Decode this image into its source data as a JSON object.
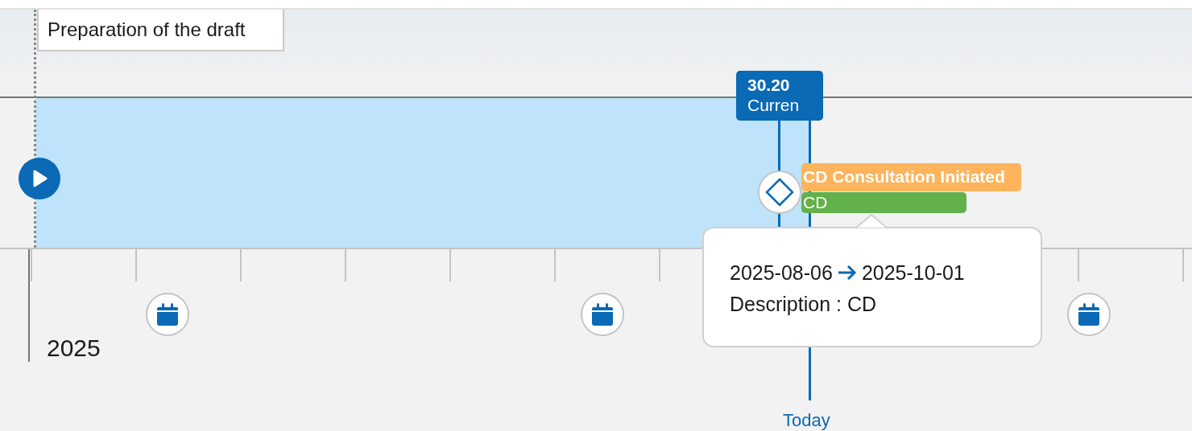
{
  "phase_label": "Preparation of the draft",
  "current_marker": {
    "value": "30.20",
    "label": "Curren"
  },
  "events": [
    {
      "title": "CD Consultation Initiated",
      "color": "#fdb45c"
    },
    {
      "title": "CD",
      "color": "#64b04a"
    }
  ],
  "tooltip": {
    "start": "2025-08-06",
    "end": "2025-10-01",
    "description": "Description : CD"
  },
  "axis": {
    "year": "2025",
    "markers": [
      {
        "kind": "calendar"
      },
      {
        "kind": "calendar"
      },
      {
        "kind": "calendar"
      }
    ]
  },
  "today_label": "Today"
}
